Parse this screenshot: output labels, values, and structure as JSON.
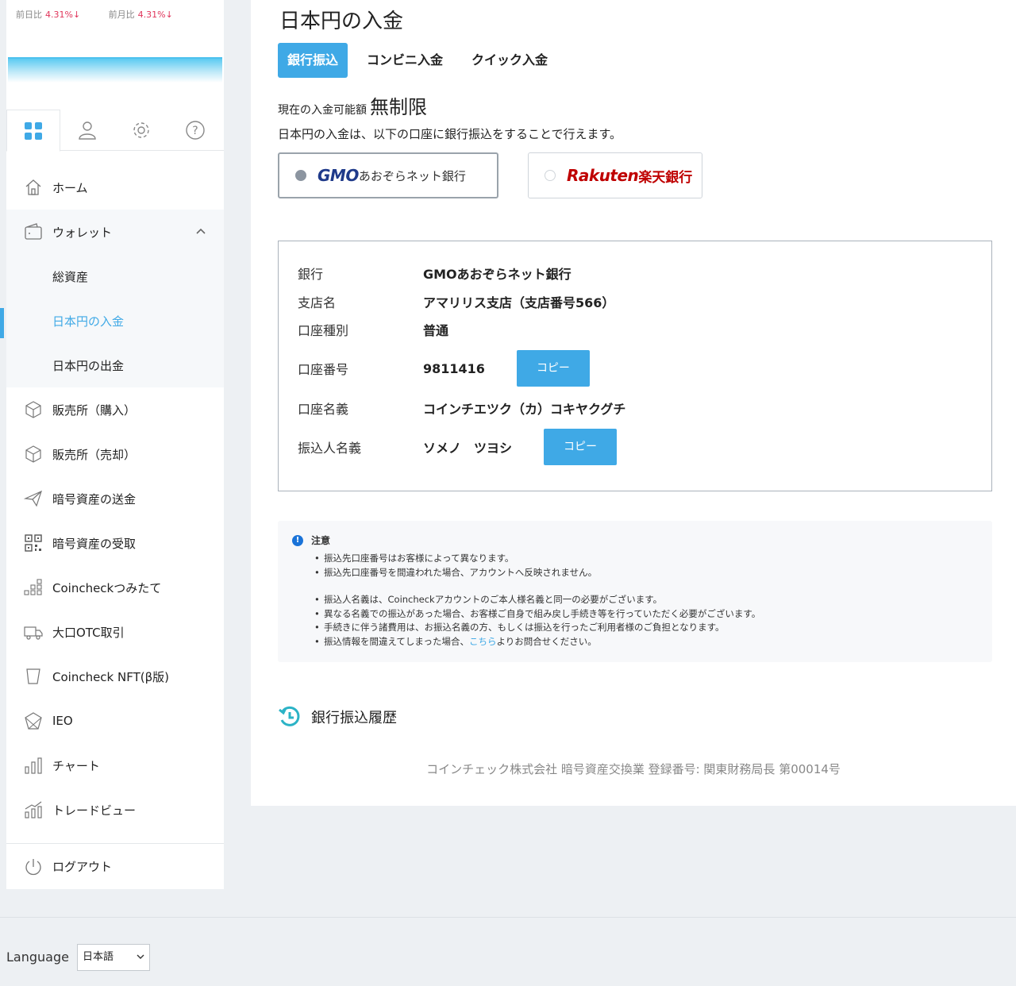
{
  "stats": [
    {
      "label": "前日比",
      "value": "4.31%↓"
    },
    {
      "label": "前月比",
      "value": "4.31%↓"
    }
  ],
  "sidebar": {
    "icon_tabs": [
      "dashboard-icon",
      "user-icon",
      "gear-icon",
      "help-icon"
    ],
    "items": {
      "home": "ホーム",
      "wallet": "ウォレット",
      "total_assets": "総資産",
      "jpy_deposit": "日本円の入金",
      "jpy_withdraw": "日本円の出金",
      "buy": "販売所（購入）",
      "sell": "販売所（売却）",
      "send": "暗号資産の送金",
      "receive": "暗号資産の受取",
      "tsumitate": "Coincheckつみたて",
      "otc": "大口OTC取引",
      "nft": "Coincheck NFT(β版)",
      "ieo": "IEO",
      "chart": "チャート",
      "tradeview": "トレードビュー"
    },
    "logout": "ログアウト"
  },
  "main": {
    "title": "日本円の入金",
    "tabs": [
      "銀行振込",
      "コンビニ入金",
      "クイック入金"
    ],
    "limit_label": "現在の入金可能額",
    "limit_value": "無制限",
    "description": "日本円の入金は、以下の口座に銀行振込をすることで行えます。",
    "banks": [
      {
        "logo": "GMO",
        "name": "あおぞらネット銀行",
        "selected": true
      },
      {
        "logo": "Rakuten",
        "name": "楽天銀行",
        "selected": false
      }
    ],
    "account": {
      "bank_label": "銀行",
      "bank_value": "GMOあおぞらネット銀行",
      "branch_label": "支店名",
      "branch_value": "アマリリス支店（支店番号566）",
      "type_label": "口座種別",
      "type_value": "普通",
      "number_label": "口座番号",
      "number_value": "9811416",
      "holder_label": "口座名義",
      "holder_value": "コインチエツク（カ）コキヤクグチ",
      "sender_label": "振込人名義",
      "sender_value": "ソメノ　ツヨシ",
      "copy_label": "コピー"
    },
    "notice": {
      "title": "注意",
      "group1": [
        "振込先口座番号はお客様によって異なります。",
        "振込先口座番号を間違われた場合、アカウントへ反映されません。"
      ],
      "group2": [
        "振込人名義は、Coincheckアカウントのご本人様名義と同一の必要がございます。",
        "異なる名義での振込があった場合、お客様ご自身で組み戻し手続き等を行っていただく必要がございます。",
        "手続きに伴う諸費用は、お振込名義の方、もしくは振込を行ったご利用者様のご負担となります。"
      ],
      "last_prefix": "振込情報を間違えてしまった場合、",
      "last_link": "こちら",
      "last_suffix": "よりお問合せください。"
    },
    "history_label": "銀行振込履歴",
    "footer": "コインチェック株式会社 暗号資産交換業 登録番号: 関東財務局長 第00014号"
  },
  "language": {
    "label": "Language",
    "selected": "日本語"
  }
}
